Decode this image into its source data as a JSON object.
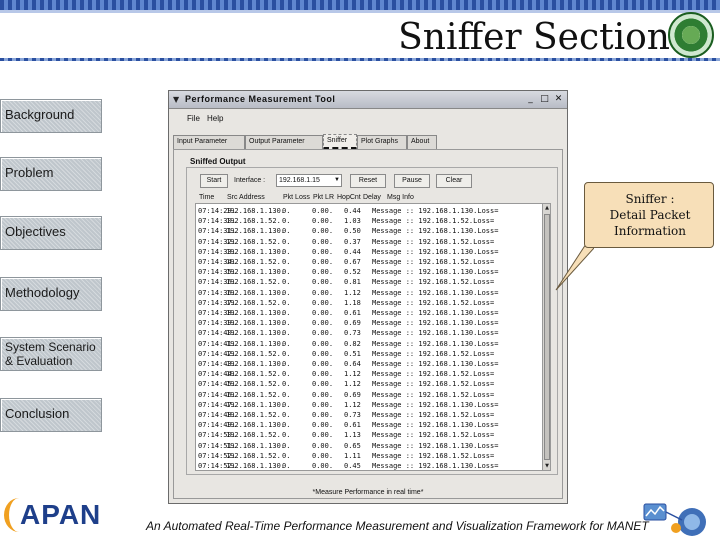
{
  "slide": {
    "title": "Sniffer Section",
    "footer": "An Automated Real-Time Performance Measurement and Visualization Framework for MANET",
    "logo_text": "APAN"
  },
  "nav": [
    {
      "label": "Background"
    },
    {
      "label": "Problem"
    },
    {
      "label": "Objectives"
    },
    {
      "label": "Methodology"
    },
    {
      "label": "System Scenario & Evaluation"
    },
    {
      "label": "Conclusion"
    }
  ],
  "window": {
    "title": "Performance Measurement Tool",
    "menu": [
      {
        "label": "File"
      },
      {
        "label": "Help"
      }
    ],
    "tabs": [
      {
        "label": "Input Parameter"
      },
      {
        "label": "Output Parameter"
      },
      {
        "label": "Sniffer"
      },
      {
        "label": "Plot Graphs"
      },
      {
        "label": "About"
      }
    ],
    "active_tab": "Sniffer",
    "panel_title": "Sniffed Output",
    "controls": {
      "start": "Start",
      "interface_label": "Interface :",
      "interface_value": "192.168.1.15",
      "reset": "Reset",
      "pause": "Pause",
      "clear": "Clear"
    },
    "columns": [
      "Time",
      "Src Address",
      "Pkt Loss",
      "Pkt LR",
      "HopCnt",
      "Delay",
      "Msg Info"
    ],
    "rows": [
      [
        "07:14:29.",
        "192.168.1.130.",
        "0.",
        "0.00.",
        "",
        "0.44",
        "Message :: 192.168.1.130.Loss="
      ],
      [
        "07:14:30.",
        "192.168.1.52.",
        "0.",
        "0.00.",
        "",
        "1.03",
        "Message :: 192.168.1.52.Loss="
      ],
      [
        "07:14:31.",
        "192.168.1.130.",
        "0.",
        "0.00.",
        "",
        "0.50",
        "Message :: 192.168.1.130.Loss="
      ],
      [
        "07:14:32.",
        "192.168.1.52.",
        "0.",
        "0.00.",
        "",
        "0.37",
        "Message :: 192.168.1.52.Loss="
      ],
      [
        "07:14:33.",
        "192.168.1.130.",
        "0.",
        "0.00.",
        "",
        "0.44",
        "Message :: 192.168.1.130.Loss="
      ],
      [
        "07:14:34.",
        "192.168.1.52.",
        "0.",
        "0.00.",
        "",
        "0.67",
        "Message :: 192.168.1.52.Loss="
      ],
      [
        "07:14:35.",
        "192.168.1.130.",
        "0.",
        "0.00.",
        "",
        "0.52",
        "Message :: 192.168.1.130.Loss="
      ],
      [
        "07:14:36.",
        "192.168.1.52.",
        "0.",
        "0.00.",
        "",
        "0.81",
        "Message :: 192.168.1.52.Loss="
      ],
      [
        "07:14:36.",
        "192.168.1.130.",
        "0.",
        "0.00.",
        "",
        "1.12",
        "Message :: 192.168.1.130.Loss="
      ],
      [
        "07:14:37.",
        "192.168.1.52.",
        "0.",
        "0.00.",
        "",
        "1.18",
        "Message :: 192.168.1.52.Loss="
      ],
      [
        "07:14:38.",
        "192.168.1.130.",
        "0.",
        "0.00.",
        "",
        "0.61",
        "Message :: 192.168.1.130.Loss="
      ],
      [
        "07:14:39.",
        "192.168.1.130.",
        "0.",
        "0.00.",
        "",
        "0.69",
        "Message :: 192.168.1.130.Loss="
      ],
      [
        "07:14:40.",
        "192.168.1.130.",
        "0.",
        "0.00.",
        "",
        "0.73",
        "Message :: 192.168.1.130.Loss="
      ],
      [
        "07:14:41.",
        "192.168.1.130.",
        "0.",
        "0.00.",
        "",
        "0.82",
        "Message :: 192.168.1.130.Loss="
      ],
      [
        "07:14:42.",
        "192.168.1.52.",
        "0.",
        "0.00.",
        "",
        "0.51",
        "Message :: 192.168.1.52.Loss="
      ],
      [
        "07:14:43.",
        "192.168.1.130.",
        "0.",
        "0.00.",
        "",
        "0.64",
        "Message :: 192.168.1.130.Loss="
      ],
      [
        "07:14:44.",
        "192.168.1.52.",
        "0.",
        "0.00.",
        "",
        "1.12",
        "Message :: 192.168.1.52.Loss="
      ],
      [
        "07:14:45.",
        "192.168.1.52.",
        "0.",
        "0.00.",
        "",
        "1.12",
        "Message :: 192.168.1.52.Loss="
      ],
      [
        "07:14:46.",
        "192.168.1.52.",
        "0.",
        "0.00.",
        "",
        "0.69",
        "Message :: 192.168.1.52.Loss="
      ],
      [
        "07:14:47.",
        "192.168.1.130.",
        "0.",
        "0.00.",
        "",
        "1.12",
        "Message :: 192.168.1.130.Loss="
      ],
      [
        "07:14:48.",
        "192.168.1.52.",
        "0.",
        "0.00.",
        "",
        "0.73",
        "Message :: 192.168.1.52.Loss="
      ],
      [
        "07:14:49.",
        "192.168.1.130.",
        "0.",
        "0.00.",
        "",
        "0.61",
        "Message :: 192.168.1.130.Loss="
      ],
      [
        "07:14:50.",
        "192.168.1.52.",
        "0.",
        "0.00.",
        "",
        "1.13",
        "Message :: 192.168.1.52.Loss="
      ],
      [
        "07:14:51.",
        "192.168.1.130.",
        "0.",
        "0.00.",
        "",
        "0.65",
        "Message :: 192.168.1.130.Loss="
      ],
      [
        "07:14:52.",
        "192.168.1.52.",
        "0.",
        "0.00.",
        "",
        "1.11",
        "Message :: 192.168.1.52.Loss="
      ],
      [
        "07:14:52.",
        "192.168.1.130.",
        "0.",
        "0.00.",
        "",
        "0.45",
        "Message :: 192.168.1.130.Loss="
      ]
    ],
    "status": "*Measure Performance in real time*"
  },
  "callout": {
    "text": "Sniffer :\nDetail Packet\nInformation"
  },
  "colors": {
    "accent_blue": "#2a4fa0",
    "nav_bg": "#bfc6cc",
    "callout_bg": "#f7dfb8",
    "apan_blue": "#1e3f8a"
  }
}
